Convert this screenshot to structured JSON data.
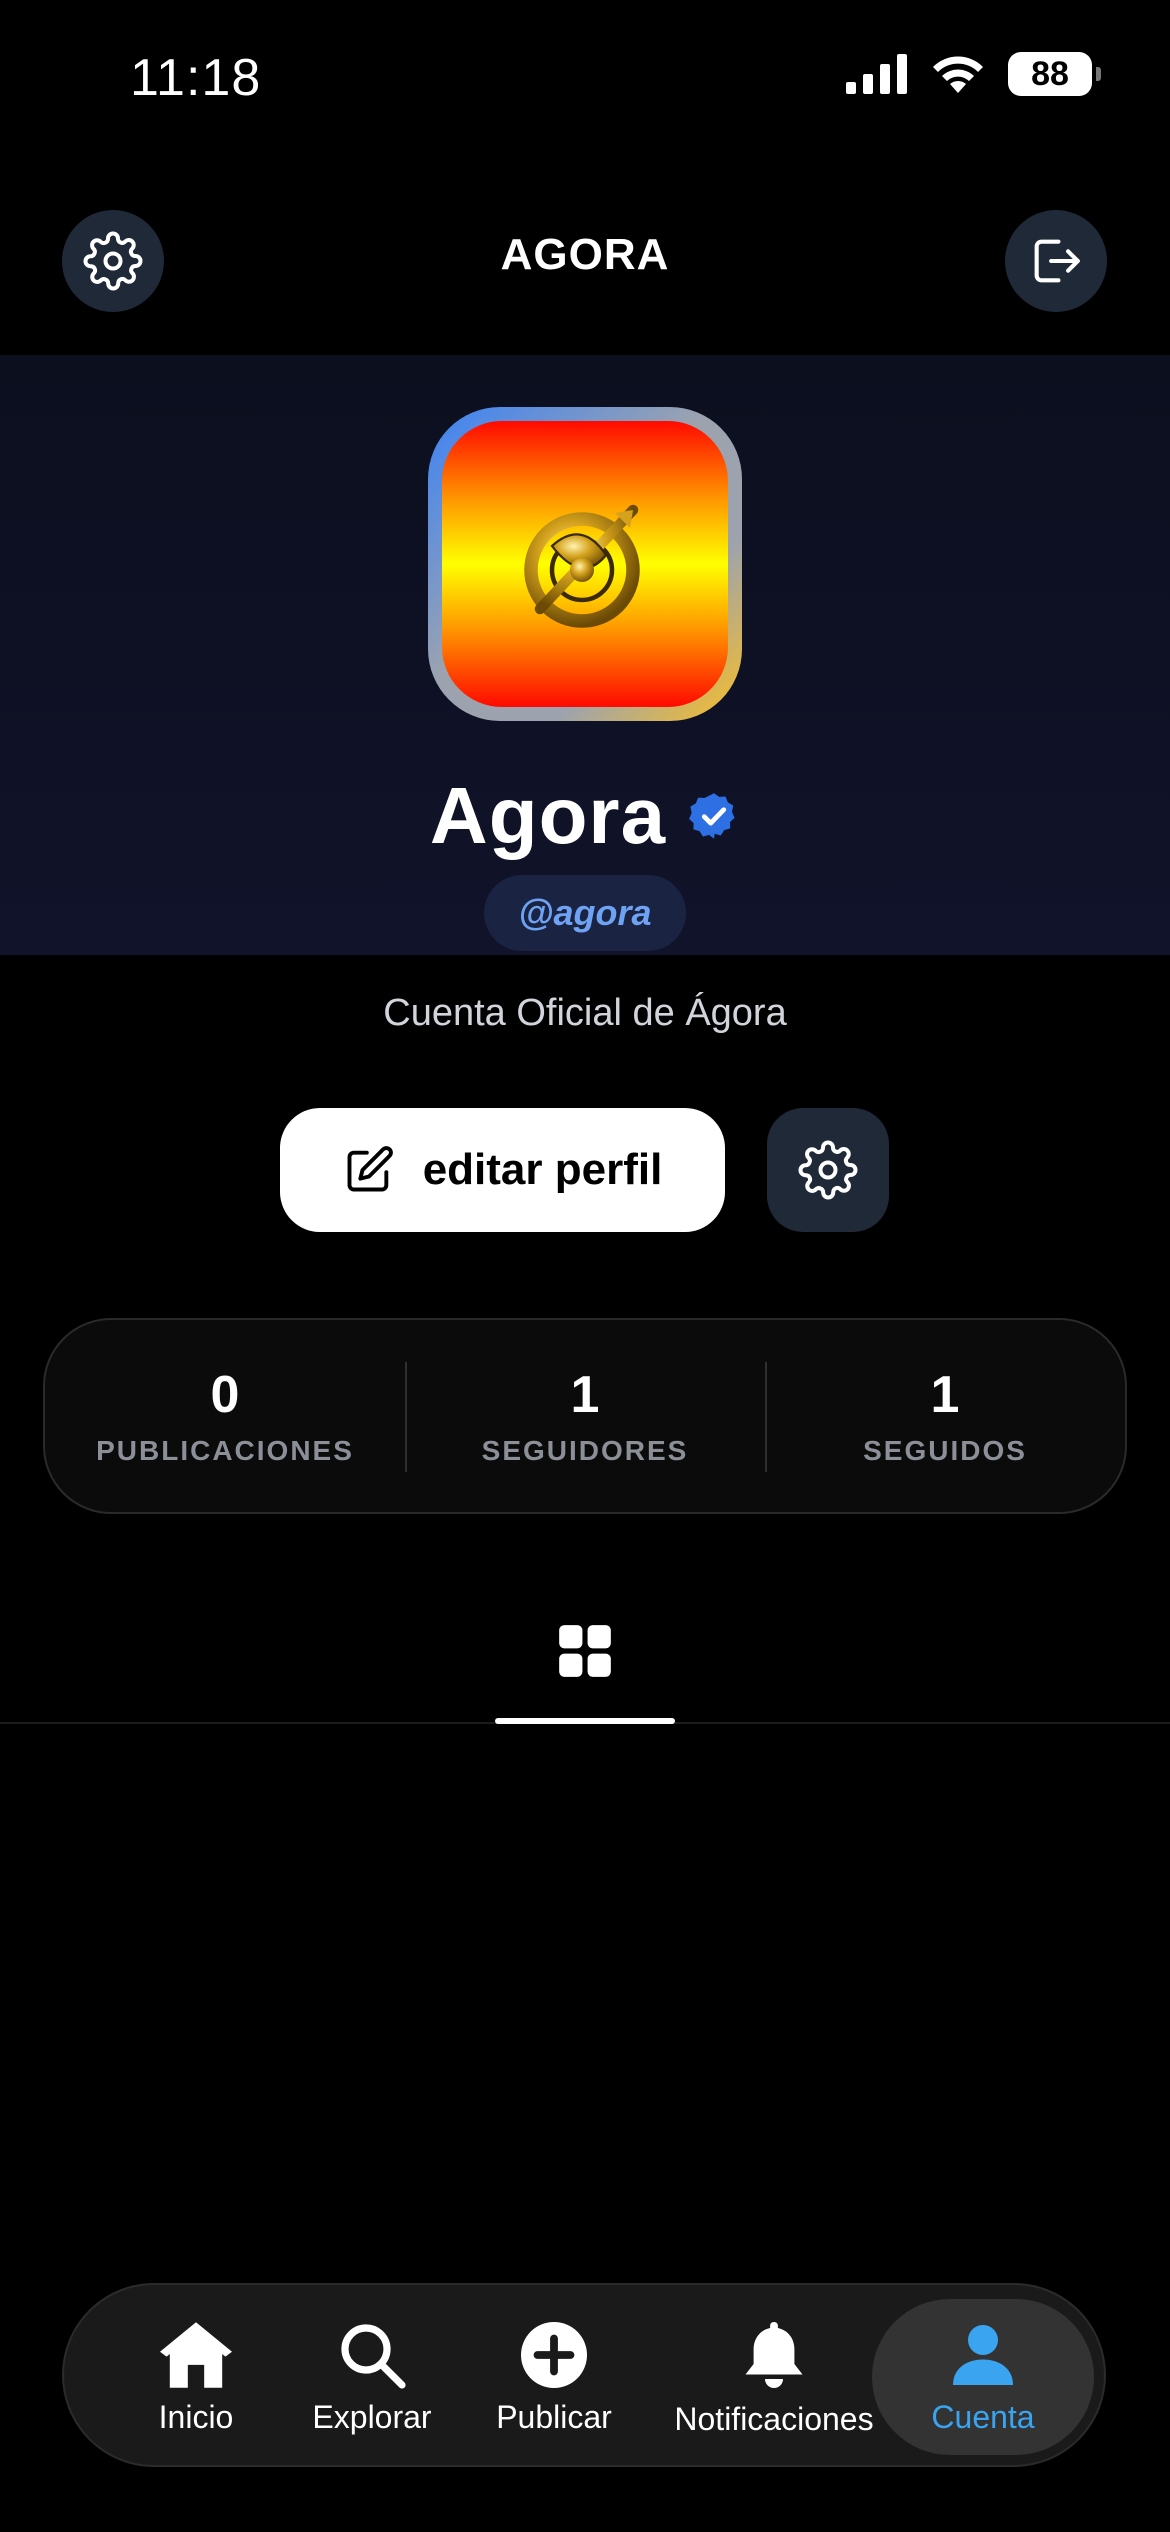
{
  "status_bar": {
    "time": "11:18",
    "battery": "88"
  },
  "header": {
    "title": "AGORA"
  },
  "profile": {
    "display_name": "Agora",
    "handle": "@agora",
    "bio": "Cuenta Oficial de Ágora",
    "verified": true
  },
  "actions": {
    "edit_profile_label": "editar perfil"
  },
  "stats": [
    {
      "value": "0",
      "label": "PUBLICACIONES"
    },
    {
      "value": "1",
      "label": "SEGUIDORES"
    },
    {
      "value": "1",
      "label": "SEGUIDOS"
    }
  ],
  "nav": {
    "items": [
      {
        "label": "Inicio",
        "icon": "home-icon"
      },
      {
        "label": "Explorar",
        "icon": "search-icon"
      },
      {
        "label": "Publicar",
        "icon": "plus-circle-icon"
      },
      {
        "label": "Notificaciones",
        "icon": "bell-icon"
      },
      {
        "label": "Cuenta",
        "icon": "user-icon",
        "active": true
      }
    ]
  },
  "colors": {
    "accent": "#3aa4f0",
    "verified_badge": "#2f6fe4",
    "handle_text": "#6ea2f3",
    "button_dark": "#1f2937"
  }
}
